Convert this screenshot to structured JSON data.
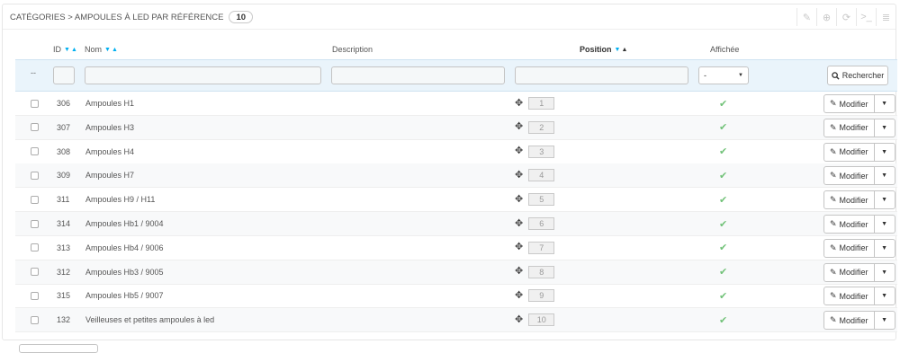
{
  "header": {
    "title": "Catégories > Ampoules à LED par référence",
    "count": "10",
    "tools": [
      {
        "icon": "edit-icon",
        "glyph": "✎"
      },
      {
        "icon": "add-icon",
        "glyph": "⊕"
      },
      {
        "icon": "refresh-icon",
        "glyph": "⟳"
      },
      {
        "icon": "terminal-icon",
        "glyph": ">_"
      },
      {
        "icon": "database-icon",
        "glyph": "≣"
      }
    ]
  },
  "columns": {
    "id": "ID",
    "name": "Nom",
    "description": "Description",
    "position": "Position",
    "shown": "Affichée"
  },
  "filters": {
    "dash": "--",
    "shown_selected": "-",
    "search_label": "Rechercher"
  },
  "rows": [
    {
      "id": "306",
      "name": "Ampoules H1",
      "position": "1"
    },
    {
      "id": "307",
      "name": "Ampoules H3",
      "position": "2"
    },
    {
      "id": "308",
      "name": "Ampoules H4",
      "position": "3"
    },
    {
      "id": "309",
      "name": "Ampoules H7",
      "position": "4"
    },
    {
      "id": "311",
      "name": "Ampoules H9 / H11",
      "position": "5"
    },
    {
      "id": "314",
      "name": "Ampoules Hb1 / 9004",
      "position": "6"
    },
    {
      "id": "313",
      "name": "Ampoules Hb4 / 9006",
      "position": "7"
    },
    {
      "id": "312",
      "name": "Ampoules Hb3 / 9005",
      "position": "8"
    },
    {
      "id": "315",
      "name": "Ampoules Hb5 / 9007",
      "position": "9"
    },
    {
      "id": "132",
      "name": "Veilleuses et petites ampoules à led",
      "position": "10"
    }
  ],
  "row_actions": {
    "edit_label": "Modifier"
  },
  "colors": {
    "accent": "#00aff0",
    "check": "#72c279",
    "filter_bg": "#eaf4fb"
  }
}
